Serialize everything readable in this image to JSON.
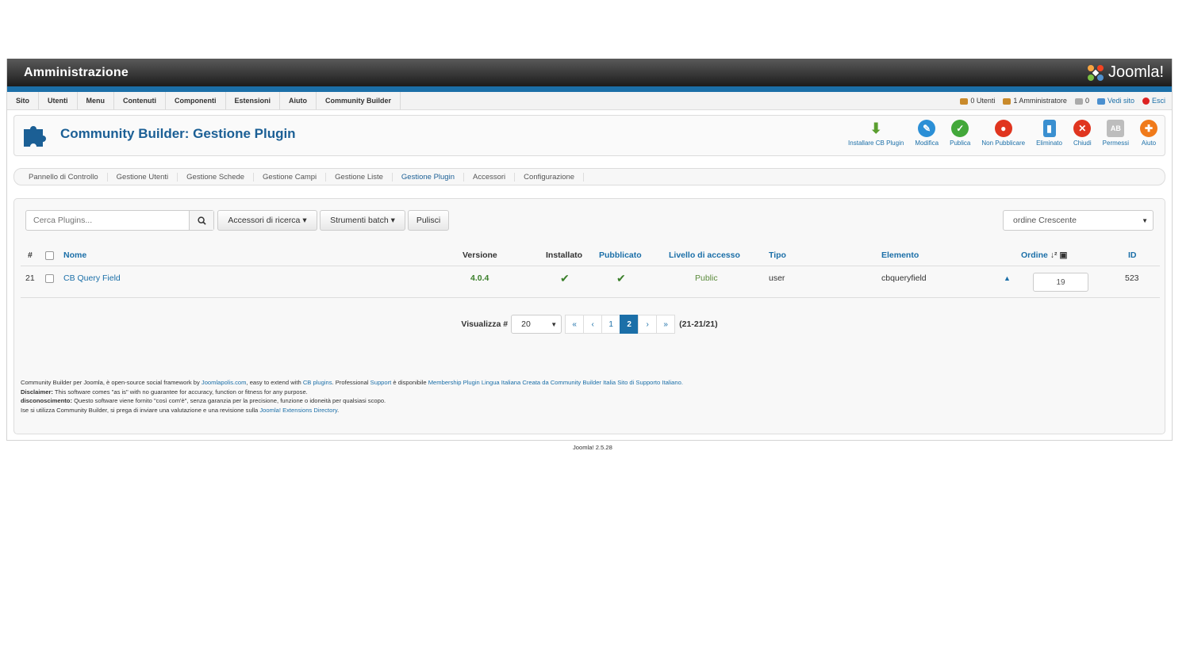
{
  "topbar": {
    "title": "Amministrazione",
    "logo_text": "Joomla!"
  },
  "menu": {
    "items": [
      "Sito",
      "Utenti",
      "Menu",
      "Contenuti",
      "Componenti",
      "Estensioni",
      "Aiuto",
      "Community Builder"
    ],
    "status": {
      "users": "0 Utenti",
      "admins": "1 Amministratore",
      "messages": "0",
      "view_site": "Vedi sito",
      "logout": "Esci"
    }
  },
  "header": {
    "title": "Community Builder: Gestione Plugin"
  },
  "toolbar": [
    {
      "label": "Installare CB Plugin",
      "icon": "download-icon",
      "color": "#5a9e2f"
    },
    {
      "label": "Modifica",
      "icon": "pencil-icon",
      "color": "#2b8fd6"
    },
    {
      "label": "Publica",
      "icon": "check-icon",
      "color": "#43a83a"
    },
    {
      "label": "Non Pubblicare",
      "icon": "stop-icon",
      "color": "#e0351f"
    },
    {
      "label": "Eliminato",
      "icon": "trash-icon",
      "color": "#3a8fd0"
    },
    {
      "label": "Chiudi",
      "icon": "close-icon",
      "color": "#e0351f"
    },
    {
      "label": "Permessi",
      "icon": "permissions-icon",
      "color": "#9a9a9a"
    },
    {
      "label": "Aiuto",
      "icon": "help-icon",
      "color": "#f07a1a"
    }
  ],
  "subnav": {
    "items": [
      "Pannello di Controllo",
      "Gestione Utenti",
      "Gestione Schede",
      "Gestione Campi",
      "Gestione Liste",
      "Gestione Plugin",
      "Accessori",
      "Configurazione"
    ],
    "active": "Gestione Plugin"
  },
  "filters": {
    "search_placeholder": "Cerca Plugins...",
    "search_tools": "Accessori di ricerca",
    "batch": "Strumenti batch",
    "clear": "Pulisci",
    "ordering": "ordine Crescente"
  },
  "table": {
    "headers": {
      "num": "#",
      "name": "Nome",
      "version": "Versione",
      "installed": "Installato",
      "published": "Pubblicato",
      "access": "Livello di accesso",
      "type": "Tipo",
      "element": "Elemento",
      "order": "Ordine",
      "id": "ID"
    },
    "rows": [
      {
        "num": "21",
        "name": "CB Query Field",
        "version": "4.0.4",
        "access": "Public",
        "type": "user",
        "element": "cbqueryfield",
        "order": "19",
        "id": "523"
      }
    ]
  },
  "pagination": {
    "label": "Visualizza #",
    "limit": "20",
    "first": "«",
    "prev": "‹",
    "pages": [
      "1",
      "2"
    ],
    "next": "›",
    "last": "»",
    "active_page": "2",
    "range": "(21-21/21)"
  },
  "footer": {
    "l1a": "Community Builder per Joomla, è open-source social framework by ",
    "l1_link1": "Joomlapolis.com",
    "l1b": ", easy to extend with ",
    "l1_link2": "CB plugins",
    "l1c": ". Professional ",
    "l1_link3": "Support",
    "l1d": " è disponibile ",
    "l1_link4": "Membership Plugin Lingua Italiana Creata da Community Builder Italia Sito di Supporto Italiano.",
    "l2_bold": "Disclaimer:",
    "l2": " This software comes \"as is\" with no guarantee for accuracy, function or fitness for any purpose.",
    "l3_bold": "disconoscimento:",
    "l3": " Questo software viene fornito \"così com'è\", senza garanzia per la precisione, funzione o idoneità per qualsiasi scopo.",
    "l4": "Ise si utilizza Community Builder, si prega di inviare una valutazione e una revisione sulla ",
    "l4_link": "Joomla! Extensions Directory",
    "l4_end": "."
  },
  "version_footer": "Joomla! 2.5.28"
}
